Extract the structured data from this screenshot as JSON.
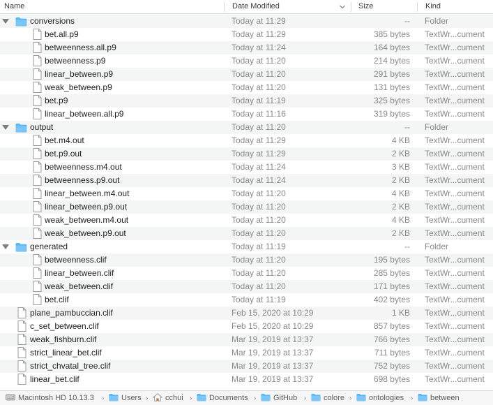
{
  "columns": {
    "name": "Name",
    "date": "Date Modified",
    "size": "Size",
    "kind": "Kind"
  },
  "rows": [
    {
      "level": 0,
      "type": "folder",
      "expanded": true,
      "name": "conversions",
      "date": "Today at 11:29",
      "size": "--",
      "kind": "Folder"
    },
    {
      "level": 1,
      "type": "file",
      "name": "bet.all.p9",
      "date": "Today at 11:29",
      "size": "385 bytes",
      "kind": "TextWr...cument"
    },
    {
      "level": 1,
      "type": "file",
      "name": "betweenness.all.p9",
      "date": "Today at 11:24",
      "size": "164 bytes",
      "kind": "TextWr...cument"
    },
    {
      "level": 1,
      "type": "file",
      "name": "betweenness.p9",
      "date": "Today at 11:20",
      "size": "214 bytes",
      "kind": "TextWr...cument"
    },
    {
      "level": 1,
      "type": "file",
      "name": "linear_between.p9",
      "date": "Today at 11:20",
      "size": "291 bytes",
      "kind": "TextWr...cument"
    },
    {
      "level": 1,
      "type": "file",
      "name": "weak_between.p9",
      "date": "Today at 11:20",
      "size": "131 bytes",
      "kind": "TextWr...cument"
    },
    {
      "level": 1,
      "type": "file",
      "name": "bet.p9",
      "date": "Today at 11:19",
      "size": "325 bytes",
      "kind": "TextWr...cument"
    },
    {
      "level": 1,
      "type": "file",
      "name": "linear_between.all.p9",
      "date": "Today at 11:16",
      "size": "319 bytes",
      "kind": "TextWr...cument"
    },
    {
      "level": 0,
      "type": "folder",
      "expanded": true,
      "name": "output",
      "date": "Today at 11:20",
      "size": "--",
      "kind": "Folder"
    },
    {
      "level": 1,
      "type": "file",
      "name": "bet.m4.out",
      "date": "Today at 11:29",
      "size": "4 KB",
      "kind": "TextWr...cument"
    },
    {
      "level": 1,
      "type": "file",
      "name": "bet.p9.out",
      "date": "Today at 11:29",
      "size": "2 KB",
      "kind": "TextWr...cument"
    },
    {
      "level": 1,
      "type": "file",
      "name": "betweenness.m4.out",
      "date": "Today at 11:24",
      "size": "3 KB",
      "kind": "TextWr...cument"
    },
    {
      "level": 1,
      "type": "file",
      "name": "betweenness.p9.out",
      "date": "Today at 11:24",
      "size": "2 KB",
      "kind": "TextWr...cument"
    },
    {
      "level": 1,
      "type": "file",
      "name": "linear_between.m4.out",
      "date": "Today at 11:20",
      "size": "4 KB",
      "kind": "TextWr...cument"
    },
    {
      "level": 1,
      "type": "file",
      "name": "linear_between.p9.out",
      "date": "Today at 11:20",
      "size": "2 KB",
      "kind": "TextWr...cument"
    },
    {
      "level": 1,
      "type": "file",
      "name": "weak_between.m4.out",
      "date": "Today at 11:20",
      "size": "4 KB",
      "kind": "TextWr...cument"
    },
    {
      "level": 1,
      "type": "file",
      "name": "weak_between.p9.out",
      "date": "Today at 11:20",
      "size": "2 KB",
      "kind": "TextWr...cument"
    },
    {
      "level": 0,
      "type": "folder",
      "expanded": true,
      "name": "generated",
      "date": "Today at 11:19",
      "size": "--",
      "kind": "Folder"
    },
    {
      "level": 1,
      "type": "file",
      "name": "betweenness.clif",
      "date": "Today at 11:20",
      "size": "195 bytes",
      "kind": "TextWr...cument"
    },
    {
      "level": 1,
      "type": "file",
      "name": "linear_between.clif",
      "date": "Today at 11:20",
      "size": "285 bytes",
      "kind": "TextWr...cument"
    },
    {
      "level": 1,
      "type": "file",
      "name": "weak_between.clif",
      "date": "Today at 11:20",
      "size": "171 bytes",
      "kind": "TextWr...cument"
    },
    {
      "level": 1,
      "type": "file",
      "name": "bet.clif",
      "date": "Today at 11:19",
      "size": "402 bytes",
      "kind": "TextWr...cument"
    },
    {
      "level": 0,
      "type": "file",
      "name": "plane_pambuccian.clif",
      "date": "Feb 15, 2020 at 10:29",
      "size": "1 KB",
      "kind": "TextWr...cument"
    },
    {
      "level": 0,
      "type": "file",
      "name": "c_set_between.clif",
      "date": "Feb 15, 2020 at 10:29",
      "size": "857 bytes",
      "kind": "TextWr...cument"
    },
    {
      "level": 0,
      "type": "file",
      "name": "weak_fishburn.clif",
      "date": "Mar 19, 2019 at 13:37",
      "size": "766 bytes",
      "kind": "TextWr...cument"
    },
    {
      "level": 0,
      "type": "file",
      "name": "strict_linear_bet.clif",
      "date": "Mar 19, 2019 at 13:37",
      "size": "711 bytes",
      "kind": "TextWr...cument"
    },
    {
      "level": 0,
      "type": "file",
      "name": "strict_chvatal_tree.clif",
      "date": "Mar 19, 2019 at 13:37",
      "size": "752 bytes",
      "kind": "TextWr...cument"
    },
    {
      "level": 0,
      "type": "file",
      "name": "linear_bet.clif",
      "date": "Mar 19, 2019 at 13:37",
      "size": "698 bytes",
      "kind": "TextWr...cument"
    }
  ],
  "pathbar": {
    "separator": "›",
    "items": [
      {
        "label": "Macintosh HD 10.13.3",
        "icon": "disk-icon"
      },
      {
        "label": "Users",
        "icon": "folder-icon"
      },
      {
        "label": "cchui",
        "icon": "home-icon"
      },
      {
        "label": "Documents",
        "icon": "folder-icon"
      },
      {
        "label": "GitHub",
        "icon": "folder-icon"
      },
      {
        "label": "colore",
        "icon": "folder-icon"
      },
      {
        "label": "ontologies",
        "icon": "folder-icon"
      },
      {
        "label": "between",
        "icon": "folder-icon"
      }
    ]
  },
  "colors": {
    "folder": "#5fb7f2",
    "stripe": "#f4f5f5",
    "muted_text": "#8a8a8a"
  }
}
